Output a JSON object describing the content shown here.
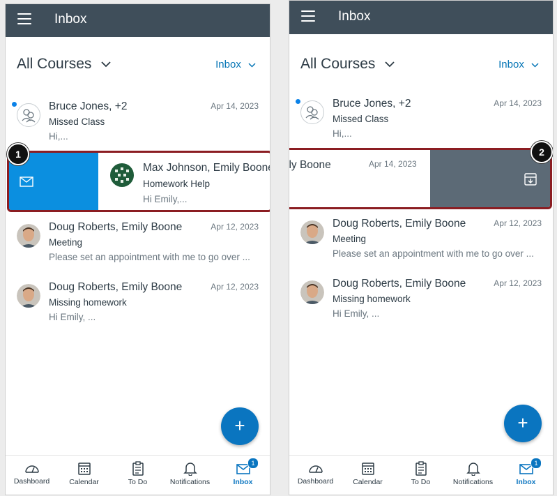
{
  "app": {
    "title": "Inbox",
    "courses_filter": "All Courses",
    "scope_filter": "Inbox"
  },
  "messages": [
    {
      "name": "Bruce Jones, +2",
      "date": "Apr 14, 2023",
      "subject": "Missed Class",
      "preview": "Hi,...",
      "unread": true
    },
    {
      "name": "Max Johnson, Emily Boone",
      "date": "Apr 14, 2023",
      "subject": "Homework Help",
      "preview": "Hi Emily,..."
    },
    {
      "name": "Doug Roberts, Emily Boone",
      "date": "Apr 12, 2023",
      "subject": "Meeting",
      "preview": "Please set an appointment with me to go over ..."
    },
    {
      "name": "Doug Roberts, Emily Boone",
      "date": "Apr 12, 2023",
      "subject": "Missing homework",
      "preview": "Hi Emily, ..."
    }
  ],
  "swiped_right": {
    "name_fragment": "ily Boone",
    "date": "Apr 14, 2023"
  },
  "callouts": {
    "first": "1",
    "second": "2"
  },
  "fab": {
    "label": "+"
  },
  "tabs": {
    "dashboard": "Dashboard",
    "calendar": "Calendar",
    "todo": "To Do",
    "notifications": "Notifications",
    "inbox": "Inbox",
    "inbox_badge": "1"
  },
  "colors": {
    "header": "#3f4e5a",
    "accent": "#0374b5",
    "mark_read_action": "#0b8fe0",
    "archive_action": "#5c6a76",
    "callout_border": "#8b1d22"
  }
}
